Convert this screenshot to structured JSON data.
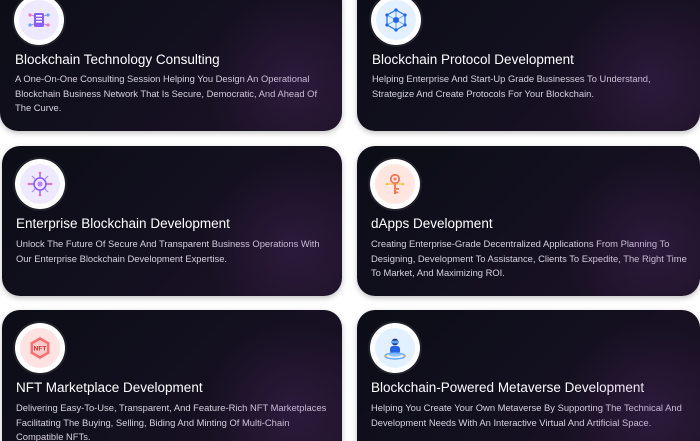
{
  "cards": [
    {
      "title": "Blockchain Technology Consulting",
      "description": "A One-On-One Consulting Session Helping You Design An Operational Blockchain Business Network That Is Secure, Democratic, And Ahead Of The Curve.",
      "icon": "consulting-grid-icon",
      "icon_color": "#a78bfa"
    },
    {
      "title": "Blockchain Protocol Development",
      "description": "Helping Enterprise And Start-Up Grade Businesses To Understand, Strategize And Create Protocols For Your Blockchain.",
      "icon": "protocol-network-icon",
      "icon_color": "#60a5fa"
    },
    {
      "title": "Enterprise Blockchain Development",
      "description": "Unlock The Future Of Secure And Transparent Business Operations With Our Enterprise Blockchain Development Expertise.",
      "icon": "enterprise-chip-icon",
      "icon_color": "#a78bfa"
    },
    {
      "title": "dApps Development",
      "description": "Creating Enterprise-Grade Decentralized Applications From Planning To Designing, Development To Assistance, Clients To Expedite, The Right Time To Market, And Maximizing ROI.",
      "icon": "dapps-key-icon",
      "icon_color": "#f9a8a8"
    },
    {
      "title": "NFT Marketplace Development",
      "description": "Delivering Easy-To-Use, Transparent, And Feature-Rich NFT Marketplaces Facilitating The Buying, Selling, Biding And Minting Of Multi-Chain Compatible NFTs.",
      "icon": "nft-badge-icon",
      "icon_color": "#f87171"
    },
    {
      "title": "Blockchain-Powered Metaverse Development",
      "description": "Helping You Create Your Own Metaverse By Supporting The Technical And Development Needs With An Interactive Virtual And Artificial Space.",
      "icon": "metaverse-avatar-icon",
      "icon_color": "#60a5fa"
    }
  ]
}
